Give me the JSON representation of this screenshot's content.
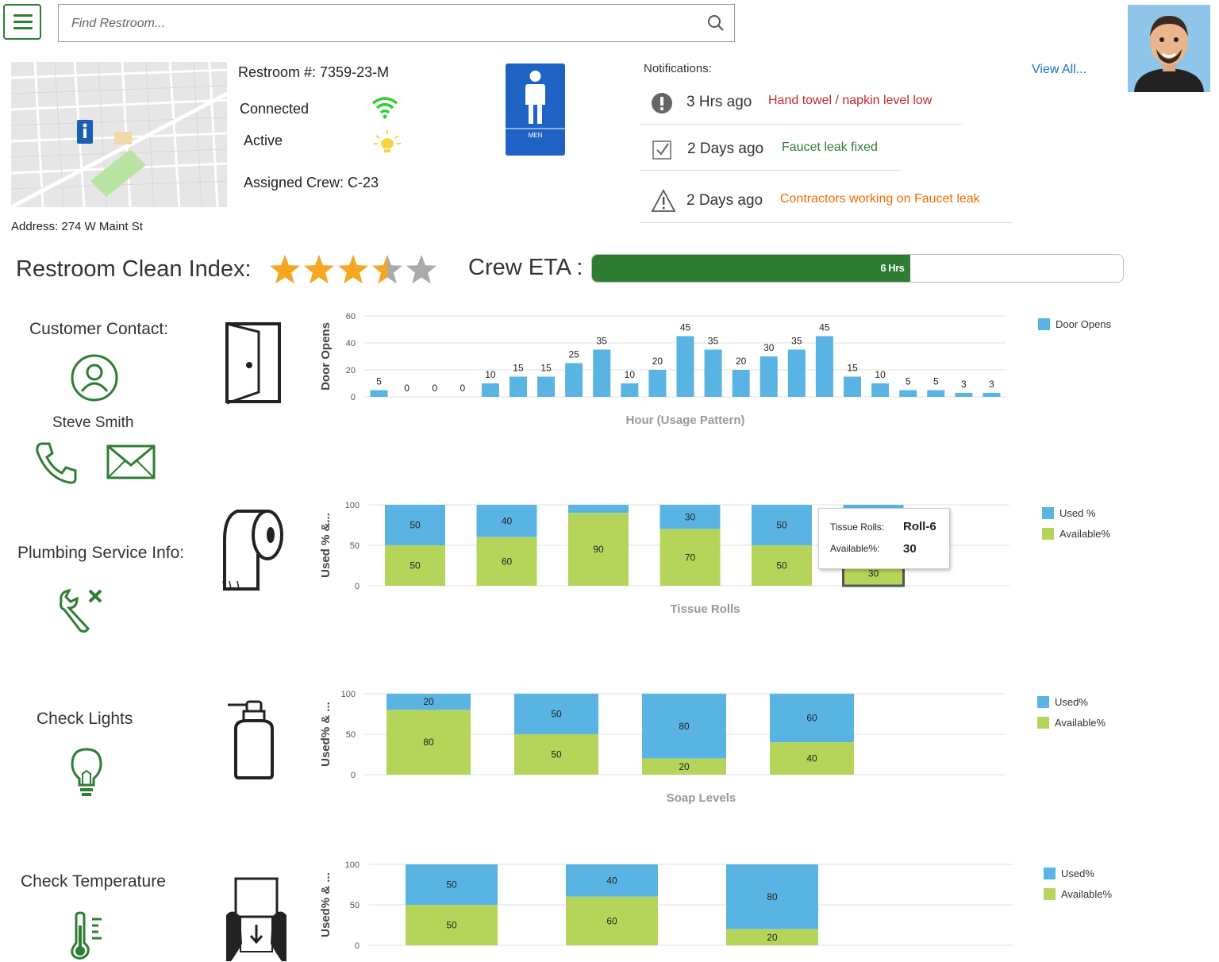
{
  "header": {
    "search_placeholder": "Find Restroom...",
    "menu_icon": "hamburger-menu-icon",
    "search_icon": "search-icon"
  },
  "restroom": {
    "number_label": "Restroom #: 7359-23-M",
    "connected_label": "Connected",
    "active_label": "Active",
    "crew_label": "Assigned Crew: C-23",
    "sign_text": "MEN",
    "address": "Address: 274 W Maint St"
  },
  "notifications": {
    "title": "Notifications:",
    "view_all": "View All...",
    "items": [
      {
        "time": "3 Hrs ago",
        "message": "Hand towel / napkin level low",
        "color": "#c62828",
        "icon": "alert-circle-icon"
      },
      {
        "time": "2 Days ago",
        "message": "Faucet leak fixed",
        "color": "#2e7d32",
        "icon": "checkbox-icon"
      },
      {
        "time": "2 Days ago",
        "message": "Contractors working on Faucet leak",
        "color": "#ef6c00",
        "icon": "warning-triangle-icon"
      }
    ]
  },
  "clean_index": {
    "label": "Restroom Clean Index:",
    "rating": 3.5,
    "max": 5
  },
  "crew_eta": {
    "label": "Crew ETA :",
    "value_label": "6 Hrs",
    "progress": 0.6
  },
  "sidebar": {
    "customer_contact": "Customer Contact:",
    "contact_name": "Steve Smith",
    "plumbing": "Plumbing Service Info:",
    "lights": "Check Lights",
    "temperature": "Check Temperature"
  },
  "colors": {
    "brand_green": "#2e7d32",
    "used_blue": "#5ab4e3",
    "available_green": "#b5d55a",
    "door_blue": "#5ab4e3",
    "star_gold": "#f5a623"
  },
  "chart_data": [
    {
      "type": "bar",
      "xlabel": "Hour (Usage Pattern)",
      "ylabel": "Door Opens",
      "ylim": [
        0,
        60
      ],
      "yticks": [
        0,
        20,
        40,
        60
      ],
      "legend": [
        "Door Opens"
      ],
      "values": [
        5,
        0,
        0,
        0,
        10,
        15,
        15,
        25,
        35,
        10,
        20,
        45,
        35,
        20,
        30,
        35,
        45,
        15,
        10,
        5,
        5,
        3,
        3
      ]
    },
    {
      "type": "bar",
      "xlabel": "Tissue Rolls",
      "ylabel": "Used % &...",
      "ylim": [
        0,
        100
      ],
      "yticks": [
        0,
        50,
        100
      ],
      "legend": [
        "Used %",
        "Available%"
      ],
      "used": [
        50,
        40,
        10,
        30,
        50,
        70
      ],
      "available": [
        50,
        60,
        90,
        70,
        50,
        30
      ],
      "used_labels": [
        "50",
        "40",
        "",
        "30",
        "50",
        ""
      ],
      "available_labels": [
        "50",
        "60",
        "90",
        "70",
        "50",
        "30"
      ],
      "tooltip": {
        "k1": "Tissue Rolls:",
        "v1": "Roll-6",
        "k2": "Available%:",
        "v2": "30"
      }
    },
    {
      "type": "bar",
      "xlabel": "Soap Levels",
      "ylabel": "Used% & ...",
      "ylim": [
        0,
        100
      ],
      "yticks": [
        0,
        50,
        100
      ],
      "legend": [
        "Used%",
        "Available%"
      ],
      "used": [
        20,
        50,
        80,
        60
      ],
      "available": [
        80,
        50,
        20,
        40
      ],
      "used_labels": [
        "20",
        "50",
        "80",
        "60"
      ],
      "available_labels": [
        "80",
        "50",
        "20",
        "40"
      ]
    },
    {
      "type": "bar",
      "xlabel": "",
      "ylabel": "Used% & ...",
      "ylim": [
        0,
        100
      ],
      "yticks": [
        0,
        50,
        100
      ],
      "legend": [
        "Used%",
        "Available%"
      ],
      "used": [
        50,
        40,
        80
      ],
      "available": [
        50,
        60,
        20
      ],
      "used_labels": [
        "50",
        "40",
        "80"
      ],
      "available_labels": [
        "50",
        "60",
        "20"
      ]
    }
  ]
}
